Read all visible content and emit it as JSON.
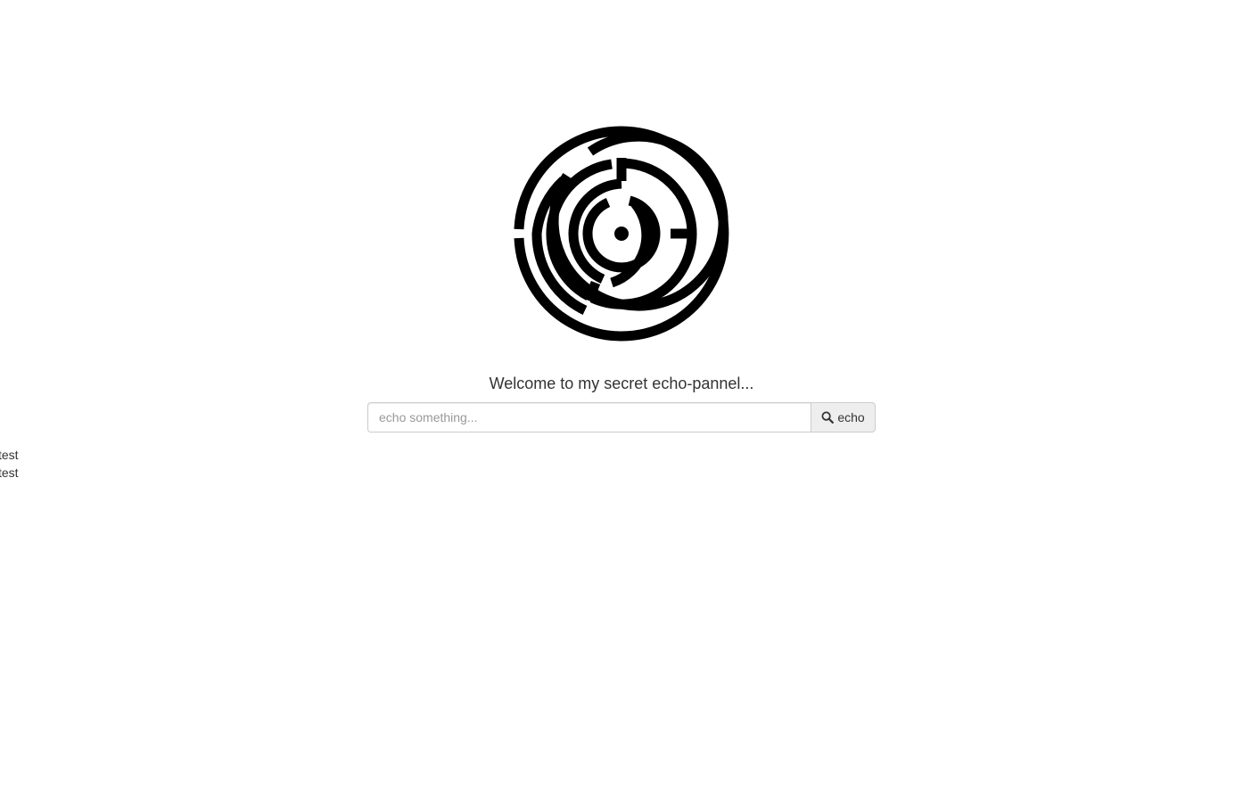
{
  "logo": {
    "icon": "maze-icon"
  },
  "welcome_text": "Welcome to my secret echo-pannel...",
  "form": {
    "input_placeholder": "echo something...",
    "input_value": "",
    "button_icon": "search-icon",
    "button_label": "echo"
  },
  "output": {
    "lines": [
      "test",
      "test"
    ]
  }
}
